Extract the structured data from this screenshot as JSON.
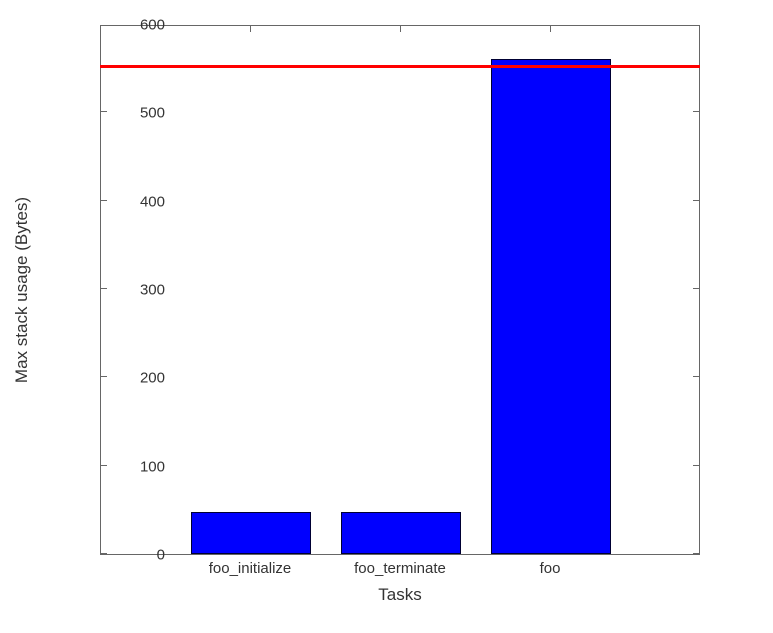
{
  "chart_data": {
    "type": "bar",
    "categories": [
      "foo_initialize",
      "foo_terminate",
      "foo"
    ],
    "values": [
      48,
      48,
      560
    ],
    "threshold": 550,
    "xlabel": "Tasks",
    "ylabel": "Max stack usage (Bytes)",
    "ylim": [
      0,
      600
    ],
    "yticks": [
      0,
      100,
      200,
      300,
      400,
      500,
      600
    ],
    "bar_color": "#0000ff",
    "threshold_color": "#ff0000"
  },
  "ytick_labels": {
    "t0": "0",
    "t100": "100",
    "t200": "200",
    "t300": "300",
    "t400": "400",
    "t500": "500",
    "t600": "600"
  },
  "xtick_labels": {
    "c0": "foo_initialize",
    "c1": "foo_terminate",
    "c2": "foo"
  },
  "axis_labels": {
    "x": "Tasks",
    "y": "Max stack usage (Bytes)"
  }
}
